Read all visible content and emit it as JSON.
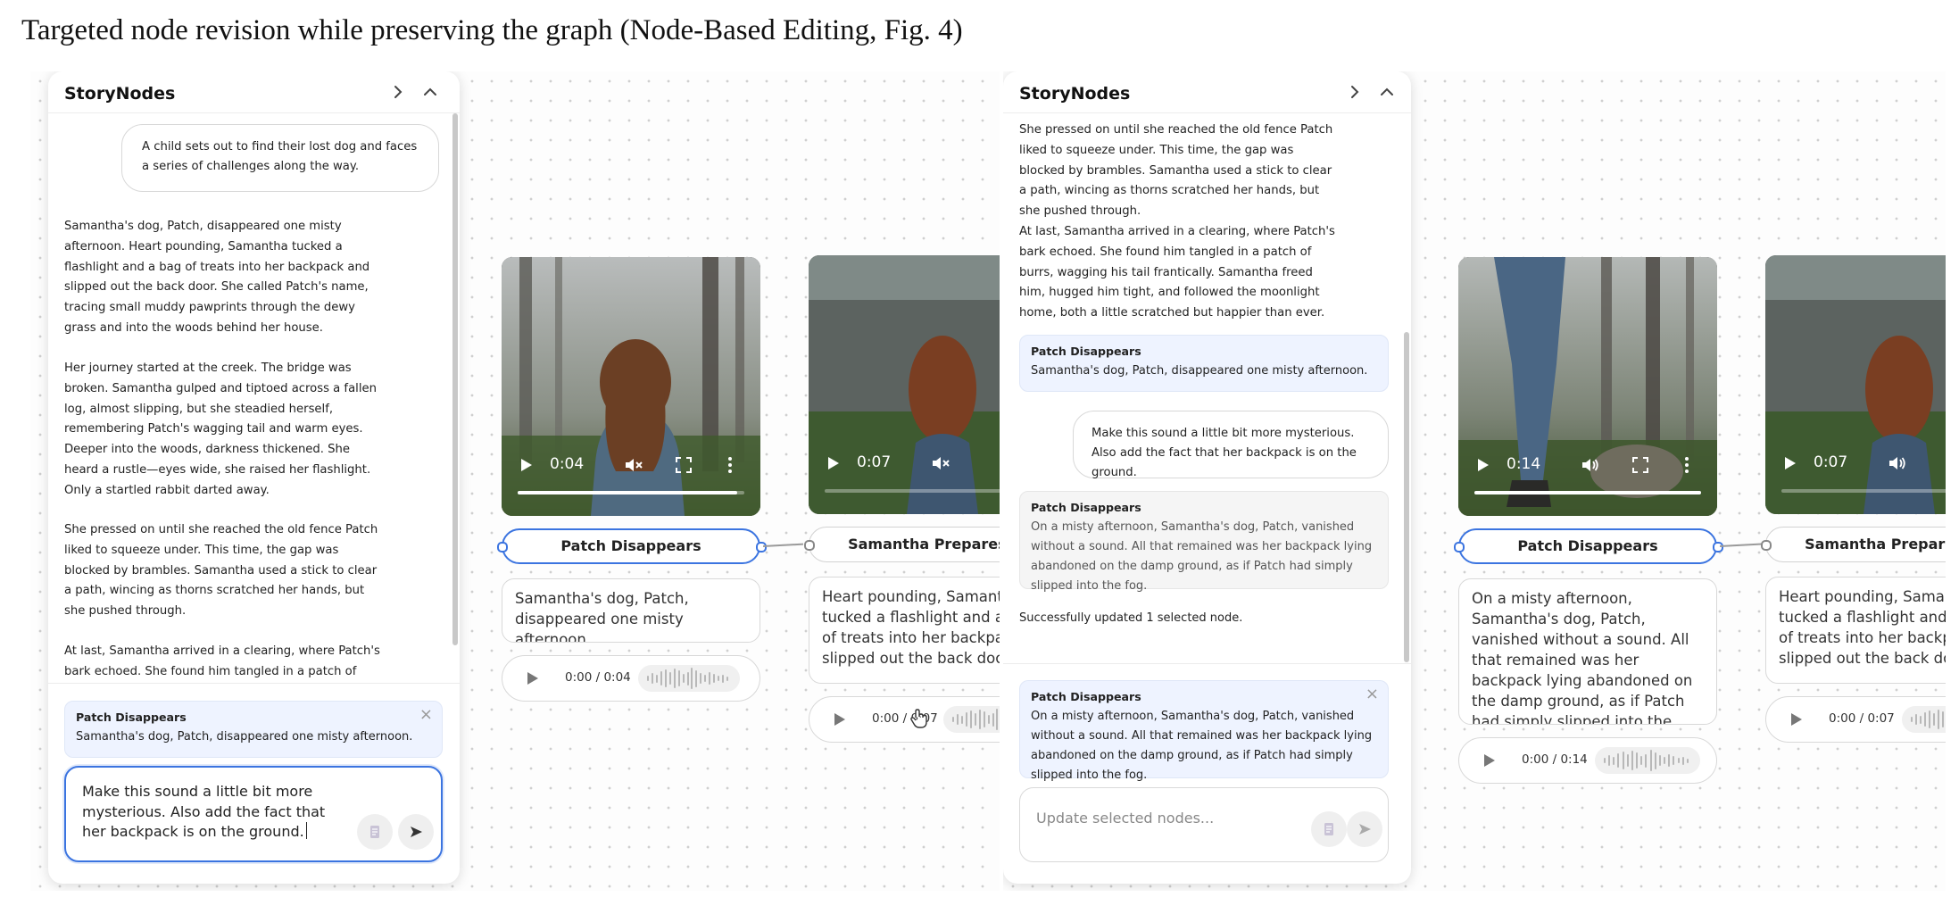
{
  "figure": {
    "caption": "Targeted node revision while preserving the graph (Node-Based Editing, Fig. 4)"
  },
  "panel_before": {
    "sidebar": {
      "title": "StoryNodes",
      "prompt_bubble": "A child sets out to find their lost dog and faces a series of challenges along the way.",
      "paragraphs": [
        "Samantha's dog, Patch, disappeared one misty afternoon. Heart pounding, Samantha tucked a flashlight and a bag of treats into her backpack and slipped out the back door. She called Patch's name, tracing small muddy pawprints through the dewy grass and into the woods behind her house.",
        "Her journey started at the creek. The bridge was broken. Samantha gulped and tiptoed across a fallen log, almost slipping, but she steadied herself, remembering Patch's wagging tail and warm eyes. Deeper into the woods, darkness thickened. She heard a rustle—eyes wide, she raised her flashlight. Only a startled rabbit darted away.",
        "She pressed on until she reached the old fence Patch liked to squeeze under. This time, the gap was blocked by brambles. Samantha used a stick to clear a path, wincing as thorns scratched her hands, but she pushed through.",
        "At last, Samantha arrived in a clearing, where Patch's bark echoed. She found him tangled in a patch of burrs, wagging his tail frantically. Samantha freed him, hugged him tight, and followed the moonlight home, both a little scratched but happier than ever."
      ],
      "selected_node": {
        "title": "Patch Disappears",
        "text": "Samantha's dog, Patch, disappeared one misty afternoon."
      },
      "input_value": "Make this sound a little bit more mysterious. Also add the fact that her backpack is on the ground."
    },
    "nodes": [
      {
        "title": "Patch Disappears",
        "video_time": "0:04",
        "text": "Samantha's dog, Patch, disappeared one misty afternoon.",
        "audio_time": "0:00 / 0:04"
      },
      {
        "title": "Samantha Prepares to",
        "video_time": "0:07",
        "text": "Heart pounding, Samantha tucked a flashlight and a bag of treats into her backpack and slipped out the back door.",
        "audio_time": "0:00 / 0:07"
      }
    ]
  },
  "panel_after": {
    "sidebar": {
      "title": "StoryNodes",
      "paragraphs": [
        "She pressed on until she reached the old fence Patch liked to squeeze under. This time, the gap was blocked by brambles. Samantha used a stick to clear a path, wincing as thorns scratched her hands, but she pushed through.",
        "At last, Samantha arrived in a clearing, where Patch's bark echoed. She found him tangled in a patch of burrs, wagging his tail frantically. Samantha freed him, hugged him tight, and followed the moonlight home, both a little scratched but happier than ever."
      ],
      "context_card": {
        "title": "Patch Disappears",
        "text": "Samantha's dog, Patch, disappeared one misty afternoon."
      },
      "user_message": "Make this sound a little bit more mysterious. Also add the fact that her backpack is on the ground.",
      "updated_card": {
        "title": "Patch Disappears",
        "text": "On a misty afternoon, Samantha's dog, Patch, vanished without a sound. All that remained was her backpack lying abandoned on the damp ground, as if Patch had simply slipped into the fog."
      },
      "status": "Successfully updated 1 selected node.",
      "selected_node": {
        "title": "Patch Disappears",
        "text": "On a misty afternoon, Samantha's dog, Patch, vanished without a sound. All that remained was her backpack lying abandoned on the damp ground, as if Patch had simply slipped into the fog."
      },
      "input_placeholder": "Update selected nodes..."
    },
    "nodes": [
      {
        "title": "Patch Disappears",
        "video_time": "0:14",
        "text": "On a misty afternoon, Samantha's dog, Patch, vanished without a sound. All that remained was her backpack lying abandoned on the damp ground, as if Patch had simply slipped into the fog.",
        "audio_time": "0:00 / 0:14"
      },
      {
        "title": "Samantha Prepares to",
        "video_time": "0:07",
        "text": "Heart pounding, Samantha tucked a flashlight and a bag of treats into her backpack and slipped out the back door.",
        "audio_time": "0:00 / 0:07"
      }
    ]
  },
  "colors": {
    "accent": "#3b74e0",
    "selected_card_bg": "#eef3ff"
  },
  "icons": [
    "chevron-right-icon",
    "chevron-up-icon",
    "play-icon",
    "mute-icon",
    "volume-icon",
    "fullscreen-icon",
    "more-icon",
    "close-icon",
    "send-icon",
    "document-icon",
    "hand-cursor-icon"
  ]
}
